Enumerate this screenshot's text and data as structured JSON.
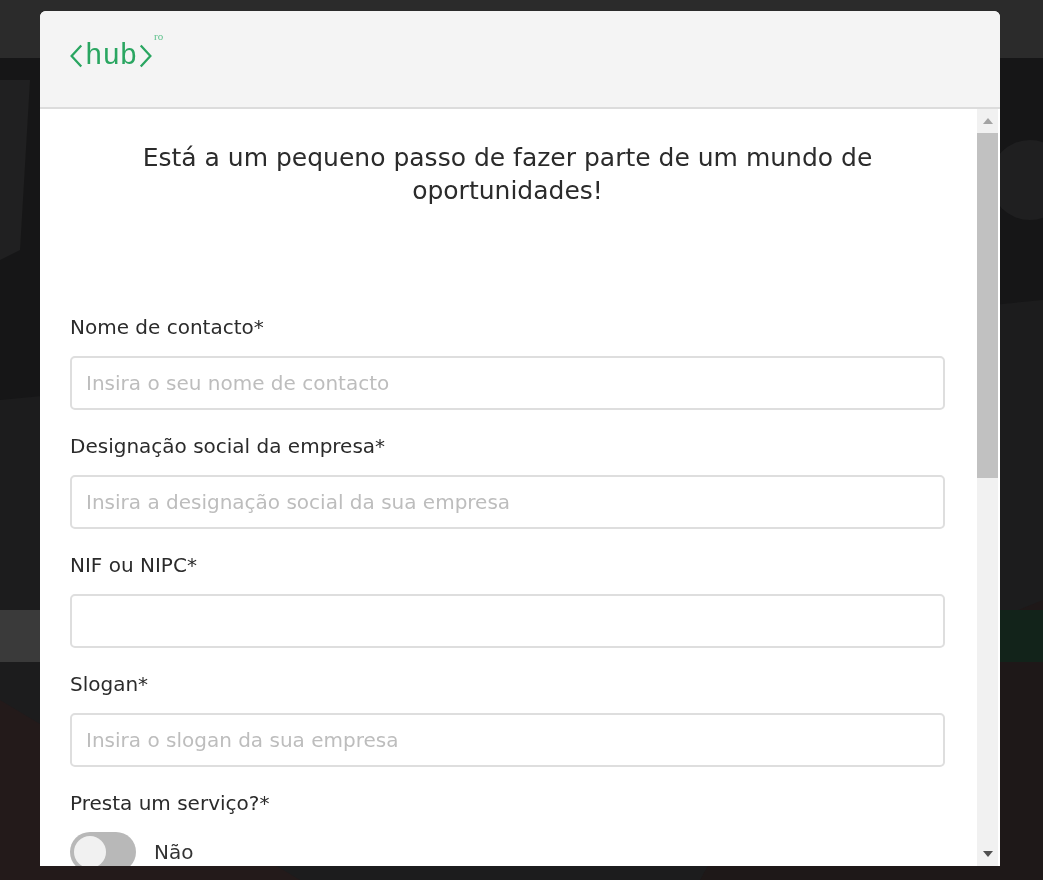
{
  "modal": {
    "logo": {
      "text": "hub",
      "superscript": "ro"
    },
    "heading": "Está a um pequeno passo de fazer parte de um mundo de oportunidades!",
    "fields": [
      {
        "kind": "text",
        "label": "Nome de contacto*",
        "placeholder": "Insira o seu nome de contacto"
      },
      {
        "kind": "text",
        "label": "Designação social da empresa*",
        "placeholder": "Insira a designação social da sua empresa"
      },
      {
        "kind": "text",
        "label": "NIF ou NIPC*"
      },
      {
        "kind": "text",
        "label": "Slogan*",
        "placeholder": "Insira o slogan da sua empresa"
      },
      {
        "kind": "toggle",
        "label": "Presta um serviço?*",
        "on": false,
        "state_label": "Não"
      }
    ]
  }
}
